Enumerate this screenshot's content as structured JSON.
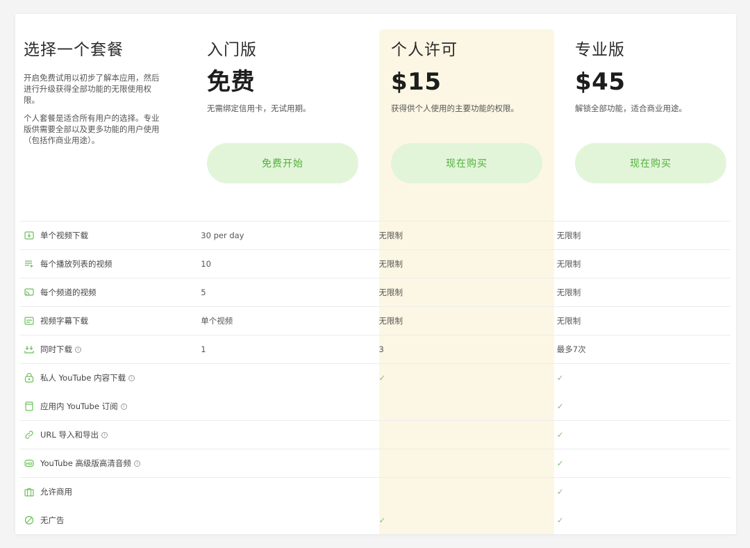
{
  "intro": {
    "title": "选择一个套餐",
    "desc1": "开启免费试用以初步了解本应用，然后进行升级获得全部功能的无限使用权限。",
    "desc2": "个人套餐是适合所有用户的选择。专业版供需要全部以及更多功能的用户使用（包括作商业用途）。"
  },
  "plans": [
    {
      "name": "入门版",
      "price": "免费",
      "desc": "无需绑定信用卡，无试用期。",
      "cta": "免费开始"
    },
    {
      "name": "个人许可",
      "price": "$15",
      "desc": "获得供个人使用的主要功能的权限。",
      "cta": "现在购买"
    },
    {
      "name": "专业版",
      "price": "$45",
      "desc": "解锁全部功能，适合商业用途。",
      "cta": "现在购买"
    }
  ],
  "features": [
    {
      "icon": "video-download-icon",
      "label": "单个视频下载",
      "info": false,
      "values": [
        "30 per day",
        "无限制",
        "无限制"
      ]
    },
    {
      "icon": "playlist-icon",
      "label": "每个播放列表的视频",
      "info": false,
      "values": [
        "10",
        "无限制",
        "无限制"
      ]
    },
    {
      "icon": "channel-icon",
      "label": "每个频道的视频",
      "info": false,
      "values": [
        "5",
        "无限制",
        "无限制"
      ]
    },
    {
      "icon": "subtitle-icon",
      "label": "视频字幕下载",
      "info": false,
      "values": [
        "单个视频",
        "无限制",
        "无限制"
      ]
    },
    {
      "icon": "concurrent-download-icon",
      "label": "同时下载",
      "info": true,
      "values": [
        "1",
        "3",
        "最多7次"
      ]
    },
    {
      "icon": "private-lock-icon",
      "label": "私人 YouTube 内容下载",
      "info": true,
      "values": [
        "",
        "✓",
        "✓"
      ]
    },
    {
      "icon": "subscription-icon",
      "label": "应用内 YouTube 订阅",
      "info": true,
      "values": [
        "",
        "",
        "✓"
      ]
    },
    {
      "icon": "link-icon",
      "label": "URL 导入和导出",
      "info": true,
      "values": [
        "",
        "",
        "✓"
      ]
    },
    {
      "icon": "hd-icon",
      "label": "YouTube 高级版高清音频",
      "info": true,
      "values": [
        "",
        "",
        "✓"
      ]
    },
    {
      "icon": "briefcase-icon",
      "label": "允许商用",
      "info": false,
      "values": [
        "",
        "",
        "✓"
      ]
    },
    {
      "icon": "no-ads-icon",
      "label": "无广告",
      "info": false,
      "values": [
        "",
        "✓",
        "✓"
      ]
    }
  ],
  "info_glyph": "i",
  "colors": {
    "accent": "#52b03a",
    "button_bg": "#e2f5d9",
    "highlight": "#fcf7e4"
  }
}
